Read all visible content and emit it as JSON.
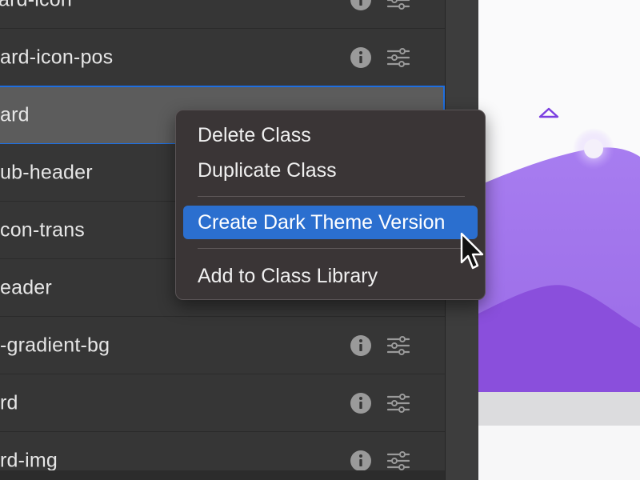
{
  "class_list": {
    "rows": [
      {
        "name": "ard-icon",
        "selected": false,
        "show_icons": true
      },
      {
        "name": "ard-icon-pos",
        "selected": false,
        "show_icons": true
      },
      {
        "name": "ard",
        "selected": true,
        "show_icons": false
      },
      {
        "name": "ub-header",
        "selected": false,
        "show_icons": false
      },
      {
        "name": "con-trans",
        "selected": false,
        "show_icons": false
      },
      {
        "name": "eader",
        "selected": false,
        "show_icons": false
      },
      {
        "name": "-gradient-bg",
        "selected": false,
        "show_icons": true
      },
      {
        "name": "rd",
        "selected": false,
        "show_icons": true
      },
      {
        "name": "rd-img",
        "selected": false,
        "show_icons": true
      }
    ],
    "icons": {
      "info": "info-icon",
      "settings": "sliders-icon"
    }
  },
  "context_menu": {
    "items": [
      {
        "label": "Delete Class",
        "highlighted": false
      },
      {
        "label": "Duplicate Class",
        "highlighted": false
      },
      {
        "label": "Create Dark Theme Version",
        "highlighted": true
      },
      {
        "label": "Add to Class Library",
        "highlighted": false
      }
    ]
  },
  "colors": {
    "selection_border": "#1f6fe0",
    "menu_highlight": "#2b6fcf",
    "preview_purple": "#9b6ce8",
    "preview_purple_dark": "#8a4fdc"
  }
}
